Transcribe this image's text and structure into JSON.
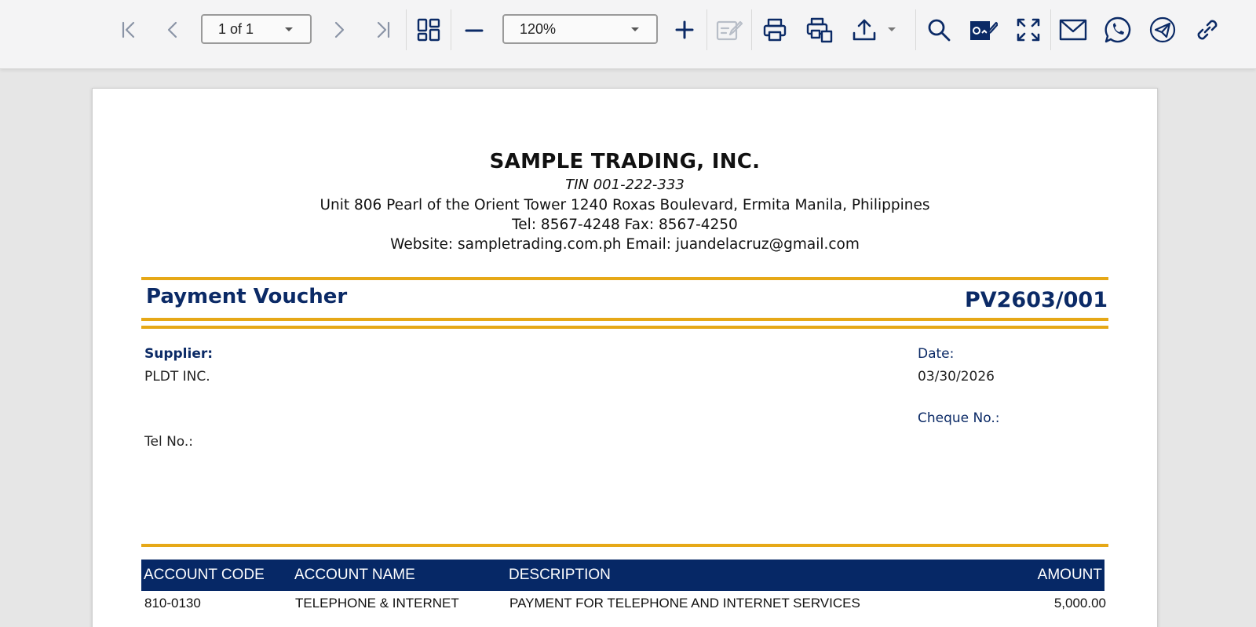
{
  "toolbar": {
    "page_indicator": "1 of 1",
    "zoom": "120%",
    "icons": [
      "first-page-icon",
      "previous-page-icon",
      "next-page-icon",
      "last-page-icon",
      "thumbnails-icon",
      "zoom-out-icon",
      "zoom-in-icon",
      "edit-icon",
      "print-icon",
      "print-layout-icon",
      "export-icon",
      "search-icon",
      "sign-icon",
      "fullscreen-icon",
      "email-icon",
      "whatsapp-icon",
      "telegram-icon",
      "link-icon"
    ]
  },
  "colors": {
    "accent_gold": "#e6a817",
    "navy": "#0b2a66",
    "header_navy": "#062866"
  },
  "company": {
    "name": "SAMPLE TRADING, INC.",
    "tin": "TIN 001-222-333",
    "address": "Unit 806 Pearl of the Orient Tower 1240 Roxas Boulevard, Ermita Manila, Philippines",
    "phones": "Tel: 8567-4248  Fax: 8567-4250",
    "web": "Website: sampletrading.com.ph  Email: juandelacruz@gmail.com"
  },
  "voucher": {
    "title": "Payment Voucher",
    "number": "PV2603/001"
  },
  "supplier": {
    "label": "Supplier:",
    "name": "PLDT INC.",
    "tel_label": "Tel No.:"
  },
  "meta": {
    "date_label": "Date:",
    "date": "03/30/2026",
    "cheque_label": "Cheque No.:"
  },
  "table": {
    "headers": {
      "code": "ACCOUNT CODE",
      "name": "ACCOUNT NAME",
      "description": "DESCRIPTION",
      "amount": "AMOUNT"
    },
    "rows": [
      {
        "code": "810-0130",
        "name": "TELEPHONE & INTERNET",
        "description": "PAYMENT FOR TELEPHONE AND INTERNET SERVICES",
        "amount": "5,000.00"
      }
    ]
  }
}
